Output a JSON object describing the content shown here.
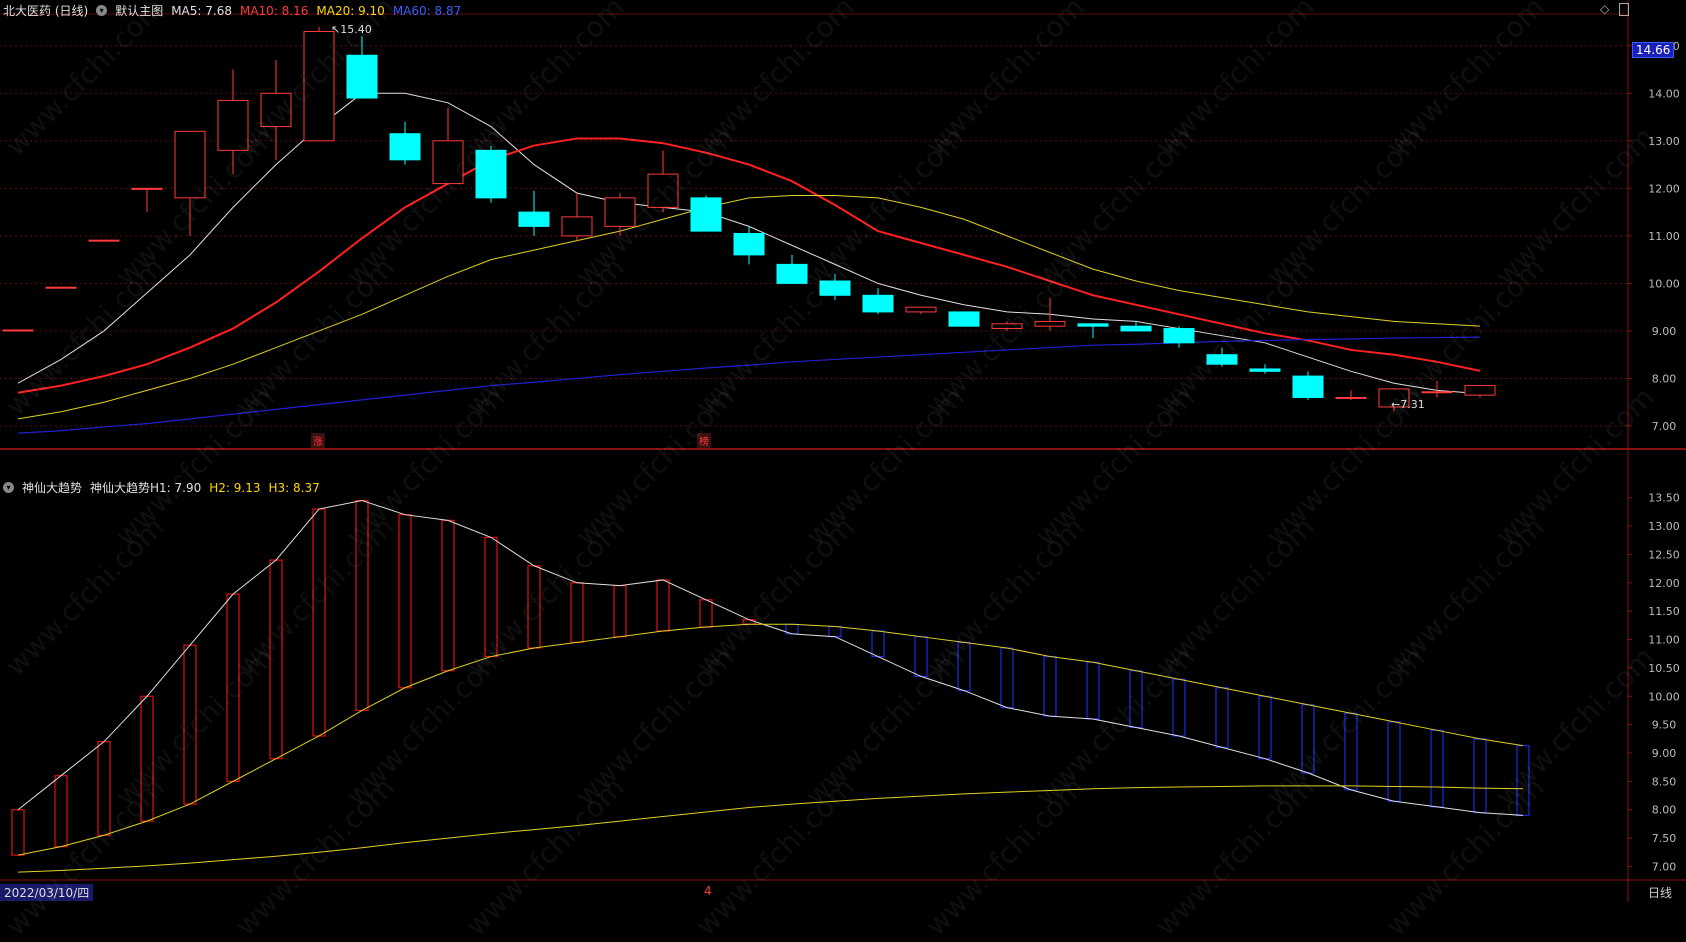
{
  "top_header": {
    "stock_name": "北大医药 (日线)",
    "template": "默认主图",
    "ma5_label": "MA5: 7.68",
    "ma10_label": "MA10: 8.16",
    "ma20_label": "MA20: 9.10",
    "ma60_label": "MA60: 8.87"
  },
  "bottom_header": {
    "indicator": "神仙大趋势",
    "h1_label": "神仙大趋势H1: 7.90",
    "h2_label": "H2: 9.13",
    "h3_label": "H3: 8.37"
  },
  "price_badge": "14.66",
  "annotations": {
    "high": "15.40",
    "low": "7.31",
    "zhang": "涨",
    "bang": "榜"
  },
  "bottom_bar": {
    "date": "2022/03/10/四",
    "marker": "4",
    "period": "日线"
  },
  "watermark": "www.cfchi.com",
  "colors": {
    "bg": "#000000",
    "up": "#ff3b3b",
    "down": "#00ffff",
    "ma5": "#e0e0e0",
    "ma10": "#ff2020",
    "ma20": "#e0d020",
    "ma60": "#2020d0"
  },
  "chart_data": [
    {
      "type": "candlestick",
      "title": "",
      "ylim": [
        6.6,
        15.5
      ],
      "yticks": [
        7.0,
        8.0,
        9.0,
        10.0,
        11.0,
        12.0,
        13.0,
        14.0,
        15.0
      ],
      "ytick_labels": [
        "7.00",
        "8.00",
        "9.00",
        "10.00",
        "11.00",
        "12.00",
        "13.00",
        "14.00",
        "15.00"
      ],
      "candles": [
        {
          "o": 9.02,
          "h": 9.02,
          "l": 9.02,
          "c": 9.02
        },
        {
          "o": 9.92,
          "h": 9.92,
          "l": 9.92,
          "c": 9.92
        },
        {
          "o": 10.91,
          "h": 10.91,
          "l": 10.91,
          "c": 10.91
        },
        {
          "o": 12.0,
          "h": 12.0,
          "l": 11.5,
          "c": 12.0
        },
        {
          "o": 11.8,
          "h": 12.0,
          "l": 11.0,
          "c": 13.2
        },
        {
          "o": 12.8,
          "h": 14.5,
          "l": 12.3,
          "c": 13.85
        },
        {
          "o": 13.3,
          "h": 14.7,
          "l": 12.6,
          "c": 14.0
        },
        {
          "o": 13.0,
          "h": 15.4,
          "l": 13.0,
          "c": 15.3
        },
        {
          "o": 14.8,
          "h": 15.2,
          "l": 13.9,
          "c": 13.9
        },
        {
          "o": 13.15,
          "h": 13.4,
          "l": 12.5,
          "c": 12.6
        },
        {
          "o": 12.1,
          "h": 13.7,
          "l": 12.1,
          "c": 13.0
        },
        {
          "o": 12.8,
          "h": 12.9,
          "l": 11.7,
          "c": 11.8
        },
        {
          "o": 11.5,
          "h": 11.95,
          "l": 11.0,
          "c": 11.2
        },
        {
          "o": 11.0,
          "h": 11.9,
          "l": 10.9,
          "c": 11.4
        },
        {
          "o": 11.2,
          "h": 11.9,
          "l": 11.0,
          "c": 11.8
        },
        {
          "o": 11.6,
          "h": 12.8,
          "l": 11.5,
          "c": 12.3
        },
        {
          "o": 11.8,
          "h": 11.85,
          "l": 11.1,
          "c": 11.1
        },
        {
          "o": 11.05,
          "h": 11.2,
          "l": 10.4,
          "c": 10.6
        },
        {
          "o": 10.4,
          "h": 10.6,
          "l": 10.0,
          "c": 10.0
        },
        {
          "o": 10.05,
          "h": 10.2,
          "l": 9.65,
          "c": 9.75
        },
        {
          "o": 9.75,
          "h": 9.9,
          "l": 9.35,
          "c": 9.4
        },
        {
          "o": 9.4,
          "h": 9.45,
          "l": 9.35,
          "c": 9.5
        },
        {
          "o": 9.4,
          "h": 9.4,
          "l": 9.1,
          "c": 9.1
        },
        {
          "o": 9.05,
          "h": 9.2,
          "l": 9.0,
          "c": 9.15
        },
        {
          "o": 9.1,
          "h": 9.7,
          "l": 9.0,
          "c": 9.2
        },
        {
          "o": 9.15,
          "h": 9.15,
          "l": 8.85,
          "c": 9.1
        },
        {
          "o": 9.1,
          "h": 9.2,
          "l": 9.0,
          "c": 9.0
        },
        {
          "o": 9.05,
          "h": 9.1,
          "l": 8.65,
          "c": 8.75
        },
        {
          "o": 8.5,
          "h": 8.65,
          "l": 8.25,
          "c": 8.3
        },
        {
          "o": 8.2,
          "h": 8.3,
          "l": 8.1,
          "c": 8.15
        },
        {
          "o": 8.05,
          "h": 8.15,
          "l": 7.55,
          "c": 7.6
        },
        {
          "o": 7.6,
          "h": 7.75,
          "l": 7.55,
          "c": 7.6
        },
        {
          "o": 7.4,
          "h": 7.8,
          "l": 7.31,
          "c": 7.78
        },
        {
          "o": 7.7,
          "h": 7.95,
          "l": 7.6,
          "c": 7.72
        },
        {
          "o": 7.65,
          "h": 7.85,
          "l": 7.6,
          "c": 7.85
        }
      ],
      "series": [
        {
          "name": "MA5",
          "values": [
            7.9,
            8.4,
            9.0,
            9.8,
            10.6,
            11.6,
            12.5,
            13.3,
            14.0,
            14.0,
            13.8,
            13.3,
            12.5,
            11.9,
            11.7,
            11.6,
            11.5,
            11.2,
            10.8,
            10.4,
            10.0,
            9.75,
            9.55,
            9.4,
            9.35,
            9.25,
            9.2,
            9.05,
            8.9,
            8.75,
            8.45,
            8.15,
            7.9,
            7.75,
            7.68
          ]
        },
        {
          "name": "MA10",
          "values": [
            7.7,
            7.85,
            8.05,
            8.3,
            8.65,
            9.05,
            9.6,
            10.25,
            10.95,
            11.6,
            12.1,
            12.6,
            12.9,
            13.05,
            13.05,
            12.95,
            12.75,
            12.5,
            12.15,
            11.65,
            11.1,
            10.85,
            10.6,
            10.35,
            10.05,
            9.75,
            9.55,
            9.35,
            9.15,
            8.95,
            8.8,
            8.6,
            8.5,
            8.35,
            8.16
          ]
        },
        {
          "name": "MA20",
          "values": [
            7.15,
            7.3,
            7.5,
            7.75,
            8.0,
            8.3,
            8.65,
            9.0,
            9.35,
            9.75,
            10.15,
            10.5,
            10.7,
            10.9,
            11.1,
            11.35,
            11.6,
            11.8,
            11.85,
            11.85,
            11.8,
            11.6,
            11.35,
            11.0,
            10.65,
            10.3,
            10.05,
            9.85,
            9.7,
            9.55,
            9.4,
            9.3,
            9.2,
            9.15,
            9.1
          ]
        },
        {
          "name": "MA60",
          "values": [
            6.85,
            6.9,
            6.98,
            7.05,
            7.15,
            7.25,
            7.35,
            7.45,
            7.55,
            7.65,
            7.75,
            7.85,
            7.92,
            8.0,
            8.08,
            8.15,
            8.22,
            8.28,
            8.35,
            8.4,
            8.45,
            8.5,
            8.55,
            8.6,
            8.65,
            8.7,
            8.72,
            8.75,
            8.78,
            8.8,
            8.82,
            8.83,
            8.85,
            8.86,
            8.87
          ]
        }
      ]
    },
    {
      "type": "band",
      "title": "",
      "ylim": [
        6.85,
        13.6
      ],
      "yticks": [
        7.0,
        7.5,
        8.0,
        8.5,
        9.0,
        9.5,
        10.0,
        10.5,
        11.0,
        11.5,
        12.0,
        12.5,
        13.0,
        13.5
      ],
      "ytick_labels": [
        "7.00",
        "7.50",
        "8.00",
        "8.50",
        "9.00",
        "9.50",
        "10.00",
        "10.50",
        "11.00",
        "11.50",
        "12.00",
        "12.50",
        "13.00",
        "13.50"
      ],
      "series": [
        {
          "name": "H1",
          "values": [
            8.0,
            8.6,
            9.2,
            10.0,
            10.9,
            11.8,
            12.4,
            13.3,
            13.45,
            13.2,
            13.1,
            12.8,
            12.3,
            12.0,
            11.95,
            12.05,
            11.7,
            11.35,
            11.1,
            11.05,
            10.7,
            10.35,
            10.1,
            9.8,
            9.65,
            9.6,
            9.45,
            9.3,
            9.1,
            8.9,
            8.65,
            8.35,
            8.15,
            8.05,
            7.95,
            7.9
          ]
        },
        {
          "name": "H2",
          "values": [
            7.2,
            7.35,
            7.55,
            7.8,
            8.1,
            8.5,
            8.9,
            9.3,
            9.75,
            10.15,
            10.45,
            10.7,
            10.85,
            10.95,
            11.05,
            11.15,
            11.22,
            11.27,
            11.27,
            11.23,
            11.15,
            11.05,
            10.95,
            10.85,
            10.7,
            10.6,
            10.45,
            10.3,
            10.15,
            10.0,
            9.85,
            9.7,
            9.55,
            9.4,
            9.25,
            9.13
          ]
        },
        {
          "name": "H3",
          "values": [
            6.9,
            6.93,
            6.97,
            7.01,
            7.06,
            7.12,
            7.18,
            7.25,
            7.33,
            7.42,
            7.5,
            7.58,
            7.65,
            7.72,
            7.8,
            7.88,
            7.96,
            8.04,
            8.1,
            8.15,
            8.2,
            8.24,
            8.28,
            8.31,
            8.34,
            8.37,
            8.39,
            8.4,
            8.41,
            8.42,
            8.42,
            8.42,
            8.41,
            8.4,
            8.38,
            8.37
          ]
        }
      ]
    }
  ]
}
